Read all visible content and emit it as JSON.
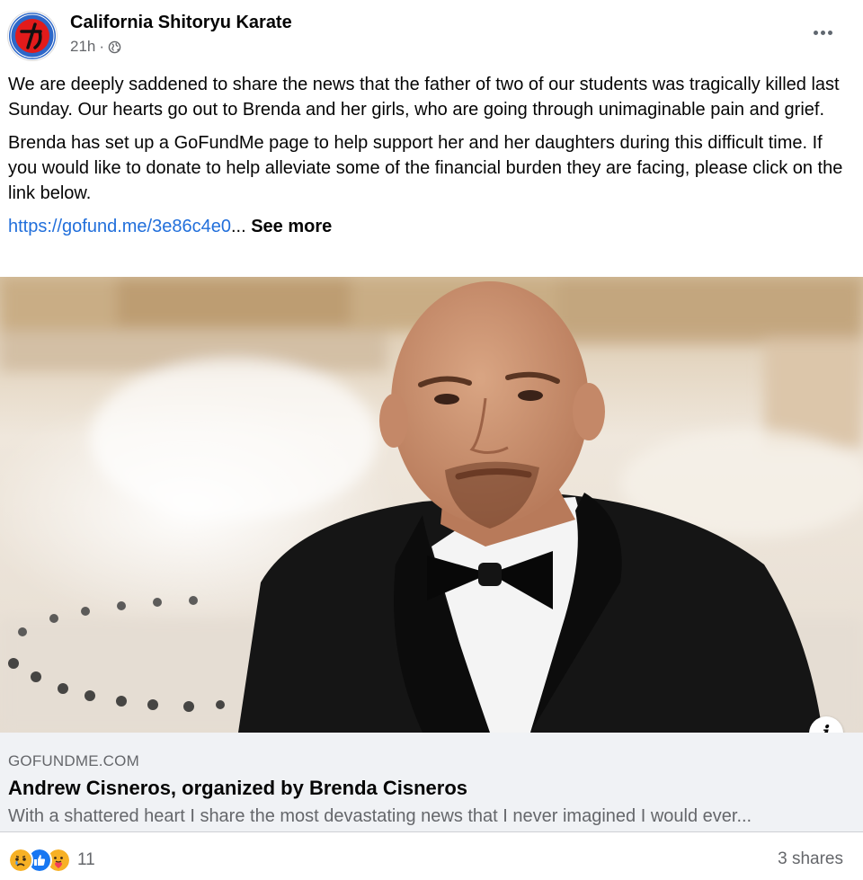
{
  "post": {
    "page_name": "California Shitoryu Karate",
    "time": "21h",
    "separator": "·",
    "privacy_icon": "globe-icon",
    "paragraphs": [
      "We are deeply saddened to share the news that the father of two of our students was tragically killed last Sunday. Our hearts go out to Brenda and her girls, who are going through unimaginable pain and grief.",
      "Brenda has set up a GoFundMe page to help support her and her daughters during this difficult time. If you would like to donate to help alleviate some of the financial burden they are facing, please click on the link below."
    ],
    "link_text": "https://gofund.me/3e86c4e0",
    "ellipsis": "...",
    "see_more": "See more"
  },
  "link_preview": {
    "domain": "GOFUNDME.COM",
    "title": "Andrew Cisneros, organized by Brenda Cisneros",
    "description": "With a shattered heart I share the most devastating news that I never imagined I would ever...",
    "info_label": "i"
  },
  "footer": {
    "reaction_icons": [
      "sad-reaction-icon",
      "like-reaction-icon",
      "care-reaction-icon"
    ],
    "reaction_count": "11",
    "shares": "3 shares"
  },
  "colors": {
    "link": "#216fdb",
    "secondary_text": "#65676b",
    "like_blue": "#1877f2",
    "reaction_yellow": "#f7b125"
  }
}
